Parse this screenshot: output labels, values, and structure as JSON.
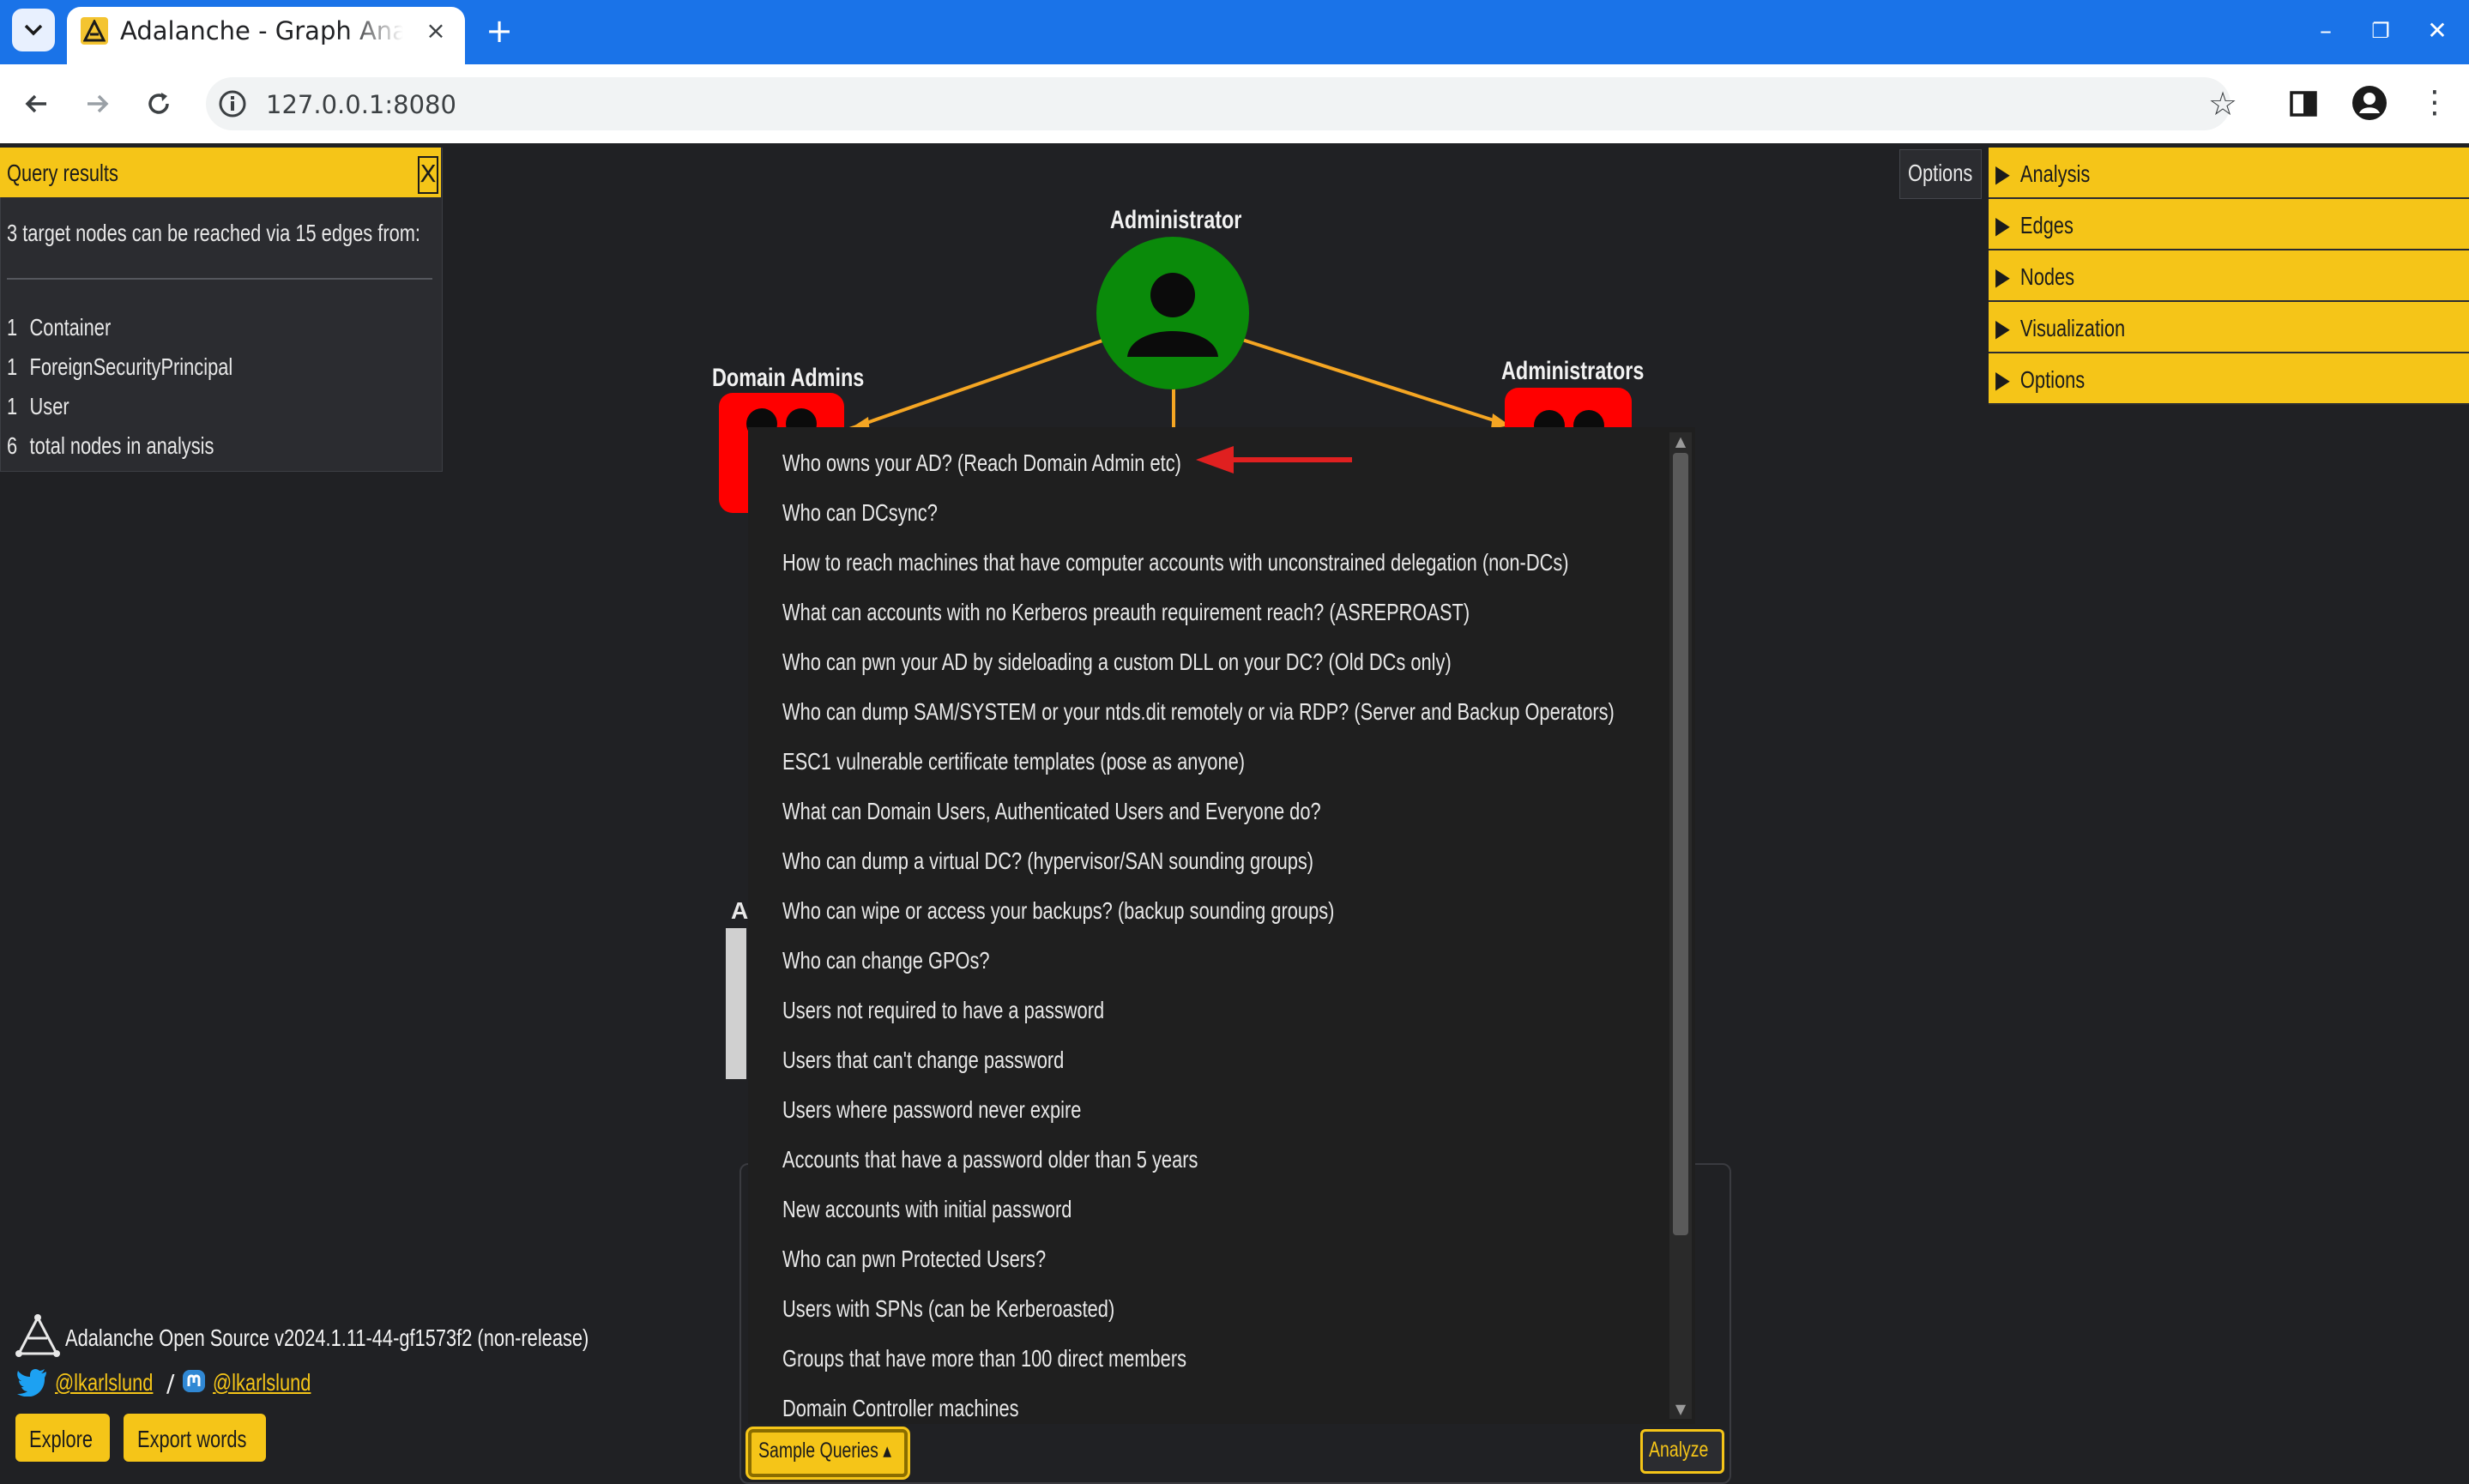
{
  "browser": {
    "tab_title": "Adalanche - Graph Analytics",
    "tab_close": "×",
    "new_tab": "+",
    "url": "127.0.0.1:8080",
    "window_controls": [
      "–",
      "❐",
      "✕"
    ]
  },
  "query_results": {
    "title": "Query results",
    "close": "X",
    "summary": "3 target nodes can be reached via 15 edges from:",
    "rows": [
      {
        "count": "1",
        "label": "Container"
      },
      {
        "count": "1",
        "label": "ForeignSecurityPrincipal"
      },
      {
        "count": "1",
        "label": "User"
      },
      {
        "count": "6",
        "label": "total nodes in analysis"
      }
    ]
  },
  "graph": {
    "nodes": [
      {
        "label": "Administrator",
        "icon": "user-icon",
        "color": "#0a8a0a"
      },
      {
        "label": "Domain Admins",
        "icon": "group-icon",
        "color": "#ff0000"
      },
      {
        "label": "Administrators",
        "icon": "group-icon",
        "color": "#ff0000"
      }
    ],
    "edge_color": "#f5a623",
    "peek_letter": "A"
  },
  "options_panel": {
    "options_button": "Options",
    "sections": [
      "Analysis",
      "Edges",
      "Nodes",
      "Visualization",
      "Options"
    ]
  },
  "sample_queries": {
    "items": [
      "Who owns your AD? (Reach Domain Admin etc)",
      "Who can DCsync?",
      "How to reach machines that have computer accounts with unconstrained delegation (non-DCs)",
      "What can accounts with no Kerberos preauth requirement reach? (ASREPROAST)",
      "Who can pwn your AD by sideloading a custom DLL on your DC? (Old DCs only)",
      "Who can dump SAM/SYSTEM or your ntds.dit remotely or via RDP? (Server and Backup Operators)",
      "ESC1 vulnerable certificate templates (pose as anyone)",
      "What can Domain Users, Authenticated Users and Everyone do?",
      "Who can dump a virtual DC? (hypervisor/SAN sounding groups)",
      "Who can wipe or access your backups? (backup sounding groups)",
      "Who can change GPOs?",
      "Users not required to have a password",
      "Users that can't change password",
      "Users where password never expire",
      "Accounts that have a password older than 5 years",
      "New accounts with initial password",
      "Who can pwn Protected Users?",
      "Users with SPNs (can be Kerberoasted)",
      "Groups that have more than 100 direct members",
      "Domain Controller machines"
    ],
    "button_label": "Sample Queries ▴",
    "analyze_label": "Analyze",
    "annotation_arrow_color": "#e02020"
  },
  "footer": {
    "version": "Adalanche Open Source v2024.1.11-44-gf1573f2 (non-release)",
    "twitter": "@lkarlslund",
    "separator": "/",
    "mastodon": "@lkarlslund",
    "buttons": [
      "Explore",
      "Export words"
    ]
  },
  "colors": {
    "accent": "#f5c518",
    "background": "#202124",
    "browser_blue": "#1a73e8"
  }
}
